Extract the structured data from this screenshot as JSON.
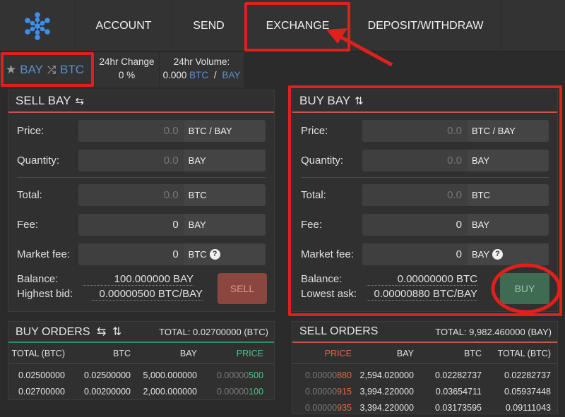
{
  "nav": {
    "logo_icon": "network-logo-icon",
    "tabs": [
      {
        "label": "ACCOUNT"
      },
      {
        "label": "SEND"
      },
      {
        "label": "EXCHANGE"
      },
      {
        "label": "DEPOSIT/WITHDRAW"
      }
    ]
  },
  "market": {
    "base": "BAY",
    "quote": "BTC",
    "change_label": "24hr Change",
    "change_value": "0",
    "change_unit": "%",
    "volume_label": "24hr Volume:",
    "volume_value": "0.000",
    "volume_btc": "BTC",
    "volume_sep": "/",
    "volume_bay": "BAY"
  },
  "sell": {
    "title": "SELL BAY",
    "price_label": "Price:",
    "price_value": "0.0",
    "price_unit": "BTC / BAY",
    "qty_label": "Quantity:",
    "qty_value": "0.0",
    "qty_unit": "BAY",
    "total_label": "Total:",
    "total_value": "0.0",
    "total_unit": "BTC",
    "fee_label": "Fee:",
    "fee_value": "0",
    "fee_unit": "BAY",
    "mfee_label": "Market fee:",
    "mfee_value": "0",
    "mfee_unit": "BTC",
    "balance_label": "Balance:",
    "balance_value": "100.000000 BAY",
    "bid_label": "Highest bid:",
    "bid_value": "0.00000500 BTC/BAY",
    "button": "SELL"
  },
  "buy": {
    "title": "BUY BAY",
    "price_label": "Price:",
    "price_value": "0.0",
    "price_unit": "BTC / BAY",
    "qty_label": "Quantity:",
    "qty_value": "0.0",
    "qty_unit": "BAY",
    "total_label": "Total:",
    "total_value": "0.0",
    "total_unit": "BTC",
    "fee_label": "Fee:",
    "fee_value": "0",
    "fee_unit": "BAY",
    "mfee_label": "Market fee:",
    "mfee_value": "0",
    "mfee_unit": "BAY",
    "balance_label": "Balance:",
    "balance_value": "0.00000000 BTC",
    "ask_label": "Lowest ask:",
    "ask_value": "0.00000880 BTC/BAY",
    "button": "BUY"
  },
  "buy_orders": {
    "title": "BUY ORDERS",
    "total": "TOTAL: 0.02700000 (BTC)",
    "columns": [
      "TOTAL (BTC)",
      "BTC",
      "BAY",
      "PRICE"
    ],
    "rows": [
      {
        "total": "0.02500000",
        "btc": "0.02500000",
        "bay": "5,000.000000",
        "price_dim": "0.00000",
        "price_hi": "500"
      },
      {
        "total": "0.02700000",
        "btc": "0.00200000",
        "bay": "2,000.000000",
        "price_dim": "0.00000",
        "price_hi": "100"
      }
    ]
  },
  "sell_orders": {
    "title": "SELL ORDERS",
    "total": "TOTAL: 9,982.460000 (BAY)",
    "columns": [
      "PRICE",
      "BAY",
      "BTC",
      "TOTAL (BTC)"
    ],
    "rows": [
      {
        "price_dim": "0.00000",
        "price_hi": "880",
        "bay": "2,594.020000",
        "btc": "0.02282737",
        "total": "0.02282737"
      },
      {
        "price_dim": "0.00000",
        "price_hi": "915",
        "bay": "3,994.220000",
        "btc": "0.03654711",
        "total": "0.05937448"
      },
      {
        "price_dim": "0.00000",
        "price_hi": "935",
        "bay": "3,394.220000",
        "btc": "0.03173595",
        "total": "0.09111043"
      }
    ]
  },
  "colors": {
    "annotation_red": "#e0201c",
    "buy_green": "#52c48a",
    "sell_orange": "#e06a48",
    "link_blue": "#5a8fd0"
  }
}
